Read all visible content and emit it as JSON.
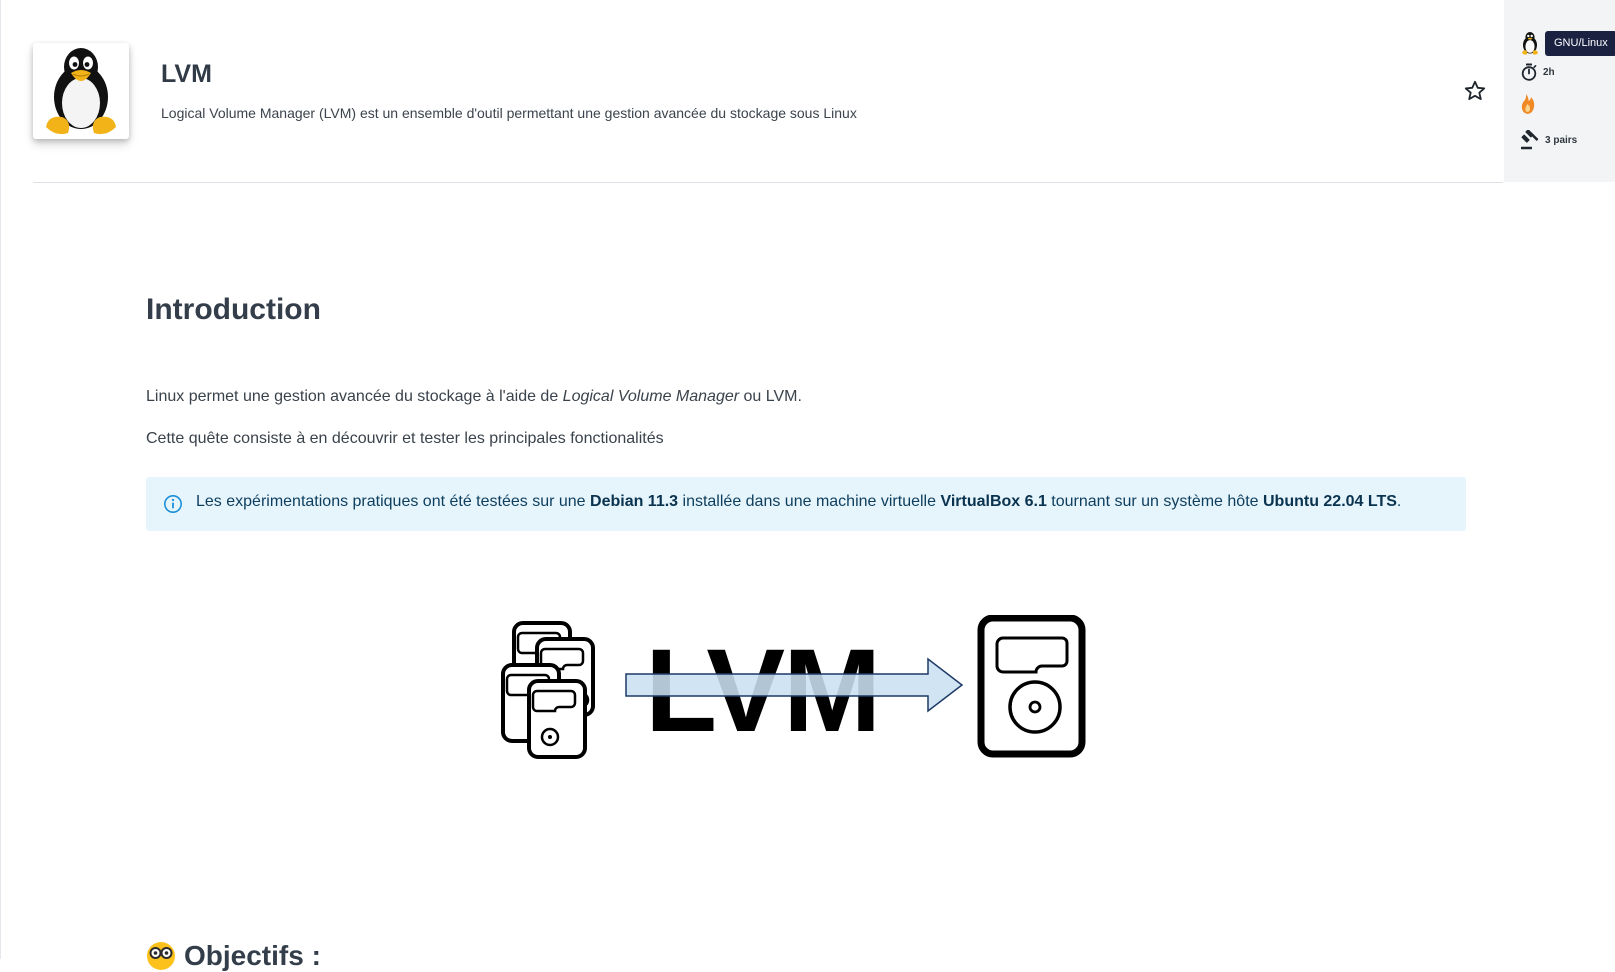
{
  "quest": {
    "title": "LVM",
    "description": "Logical Volume Manager (LVM) est un ensemble d'outil permettant une gestion avancée du stockage sous Linux"
  },
  "meta": {
    "category_tooltip": "GNU/Linux",
    "duration": "2h",
    "peers": "3 pairs"
  },
  "content": {
    "intro_heading": "Introduction",
    "para1_before": "Linux permet une gestion avancée du stockage à l'aide de ",
    "para1_em": "Logical Volume Manager",
    "para1_after": " ou LVM.",
    "para2": "Cette quête consiste à en découvrir et tester les principales fonctionalités",
    "info": {
      "t1": "Les expérimentations pratiques ont été testées sur une ",
      "b1": "Debian 11.3",
      "t2": " installée dans une machine virtuelle ",
      "b2": "VirtualBox 6.1",
      "t3": " tournant sur un système hôte ",
      "b3": "Ubuntu 22.04 LTS",
      "t4": "."
    },
    "illustration_text": "LVM",
    "objectives_heading": "Objectifs :"
  },
  "icons": {
    "quest_logo": "tux-penguin-icon",
    "favorite": "star-outline-icon",
    "category": "tux-penguin-icon",
    "duration": "stopwatch-icon",
    "difficulty": "flame-icon",
    "peers": "gavel-icon",
    "info": "info-circle-icon"
  },
  "colors": {
    "info_bg": "#e6f4fb",
    "info_text": "#0d3e5e",
    "tooltip_bg": "#1b2141",
    "flame": "#f08a24",
    "side_panel_bg": "#f3f4f5"
  }
}
